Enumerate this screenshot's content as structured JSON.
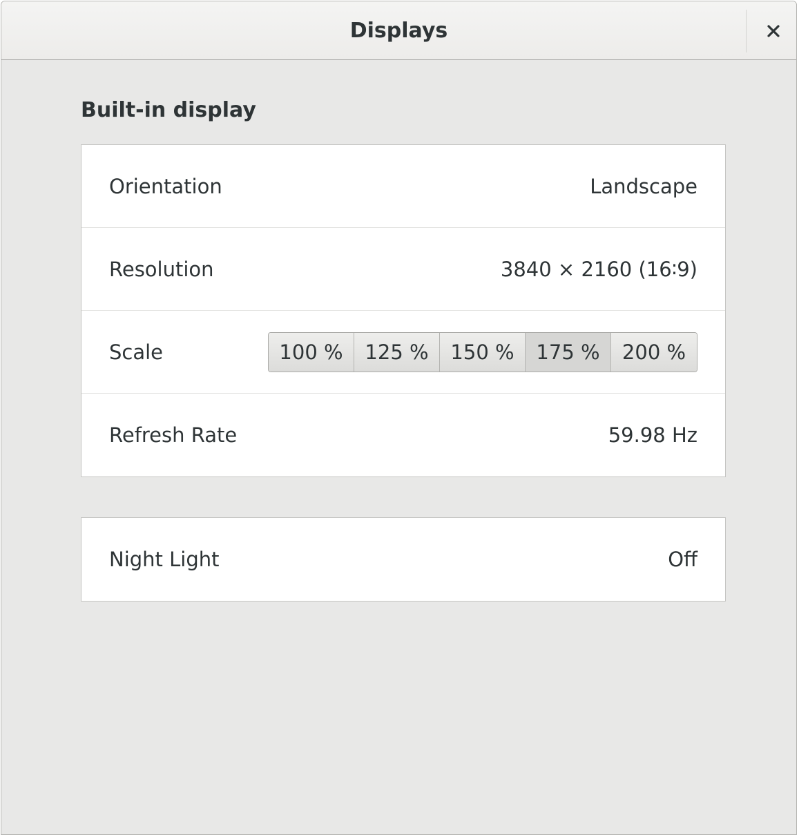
{
  "window": {
    "title": "Displays",
    "close_icon": "close-icon"
  },
  "section": {
    "heading": "Built-in display"
  },
  "rows": {
    "orientation": {
      "label": "Orientation",
      "value": "Landscape"
    },
    "resolution": {
      "label": "Resolution",
      "value": "3840 × 2160 (16∶9)"
    },
    "scale": {
      "label": "Scale",
      "options": [
        "100 %",
        "125 %",
        "150 %",
        "175 %",
        "200 %"
      ],
      "selected": "175 %"
    },
    "refresh_rate": {
      "label": "Refresh Rate",
      "value": "59.98 Hz"
    }
  },
  "night_light": {
    "label": "Night Light",
    "value": "Off"
  },
  "colors": {
    "window_bg": "#e8e8e7",
    "list_bg": "#ffffff",
    "text": "#2e3436"
  }
}
